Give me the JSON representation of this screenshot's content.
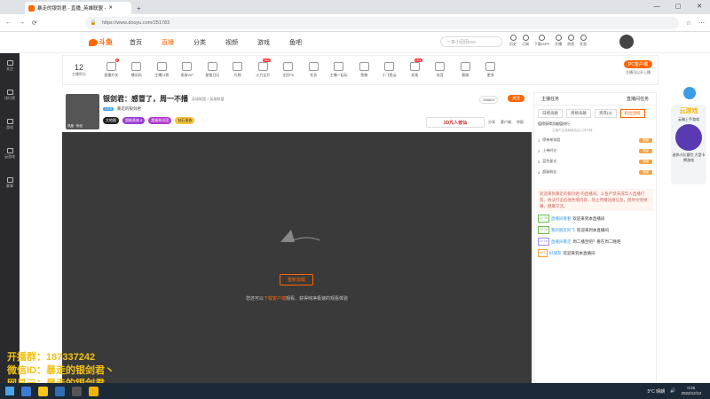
{
  "browser": {
    "tab_title": "暴走的银剑君 - 直播_英雄联盟 -",
    "url": "https://www.douyu.com/251783"
  },
  "leftbar": {
    "items": [
      "关注",
      "排行榜",
      "游戏",
      "云游戏",
      "赛事"
    ]
  },
  "nav": {
    "logo": "斗鱼",
    "links": [
      "首页",
      "直播",
      "分类",
      "视频",
      "游戏",
      "鱼吧"
    ],
    "search_placeholder": "一条小团团ovo",
    "icons": [
      "历史",
      "订阅",
      "下载/APP",
      "开播",
      "消息",
      "任务"
    ]
  },
  "toolbar": {
    "rank_num": "12",
    "rank_label": "主播积分",
    "items": [
      {
        "label": "直播开关",
        "badge": "2"
      },
      {
        "label": "播况码",
        "badge": ""
      },
      {
        "label": "主播口袋",
        "badge": ""
      },
      {
        "label": "贵族VIP",
        "badge": ""
      },
      {
        "label": "星推日历",
        "badge": ""
      },
      {
        "label": "礼物",
        "badge": ""
      },
      {
        "label": "火力全开",
        "badge": "New"
      },
      {
        "label": "全民PK",
        "badge": ""
      },
      {
        "label": "任务",
        "badge": ""
      },
      {
        "label": "主播一起玩",
        "badge": ""
      },
      {
        "label": "鱼粮",
        "badge": ""
      },
      {
        "label": "小飞鱼云",
        "badge": ""
      },
      {
        "label": "发现",
        "badge": "New"
      },
      {
        "label": "电竞",
        "badge": ""
      },
      {
        "label": "客服",
        "badge": ""
      },
      {
        "label": "更多",
        "badge": ""
      }
    ],
    "pc_button": "PC客户端",
    "pc_sub": "主播可以开上播"
  },
  "stream": {
    "title": "银剑君：感冒了，周一不播",
    "tag": "体验",
    "category": "英雄联盟 > 英雄联盟",
    "level": "LV15",
    "streamer": "暴走的银剑君",
    "cover_text": "热度 · 粉丝",
    "pills": [
      "大地图",
      "超能贵族 6",
      "超级粉丝团",
      "钻石贵族"
    ],
    "hot": "288813",
    "follow": "关注",
    "sponsor": "3D凡人修仙",
    "actions": [
      "分享",
      "客户端",
      "举报"
    ]
  },
  "player": {
    "reload": "重新加载",
    "text_pre": "您还可以",
    "text_link": "下载客户端",
    "text_post": "观看，获得纯净极速的观看体验"
  },
  "right": {
    "tabs": [
      "主播任务",
      "直播间任务"
    ],
    "subtabs": [
      "日榜贡献",
      "周榜贡献",
      "贵宾(4)",
      "粉丝团榜"
    ],
    "note": "值得获得贡献值排行",
    "note2": "主播产生贡献值会加入排行榜",
    "ranks": [
      {
        "num": "1",
        "name": "缪神单排君",
        "badge": "贡献"
      },
      {
        "num": "2",
        "name": "上帝时光",
        "badge": "贡献"
      },
      {
        "num": "3",
        "name": "蓝色星光",
        "badge": "贡献"
      },
      {
        "num": "4",
        "name": "超级粉丝",
        "badge": "贡献"
      }
    ],
    "chat": {
      "welcome": "欢迎来到暴走的银剑君 的直播间。斗鱼严禁未成年人直播打赏。依法打击低俗色情内容，禁止传播违规信息，倡导文明弹幕，健康交流。",
      "messages": [
        {
          "badge": "LV 36",
          "user": "直播间看看",
          "text": "欢迎来到本直播间"
        },
        {
          "badge": "LV 15",
          "user": "我的朋友阿飞",
          "text": "欢迎来到本直播间"
        },
        {
          "badge": "LV 16",
          "user": "直播间暴走",
          "text": "周二播至吧？看在周二晚吧"
        },
        {
          "badge": "LV 5",
          "user": "好朋友",
          "text": "欢迎来到本直播间"
        }
      ]
    }
  },
  "side_ad": {
    "title": "云游戏",
    "sub": "云端上手游戏",
    "foot": "迷你小队冒险 大型卡牌游戏"
  },
  "overlay": {
    "lines": [
      "开播群：187337242",
      "微信ID：暴走的银剑君丶",
      "网易云：暴走的银剑君"
    ]
  },
  "taskbar": {
    "weather": "5°C 晴朗",
    "time": "0:25",
    "date": "2022/12/13"
  },
  "colors": {
    "accent": "#ff6600",
    "player_bg": "#3a3a3a"
  }
}
